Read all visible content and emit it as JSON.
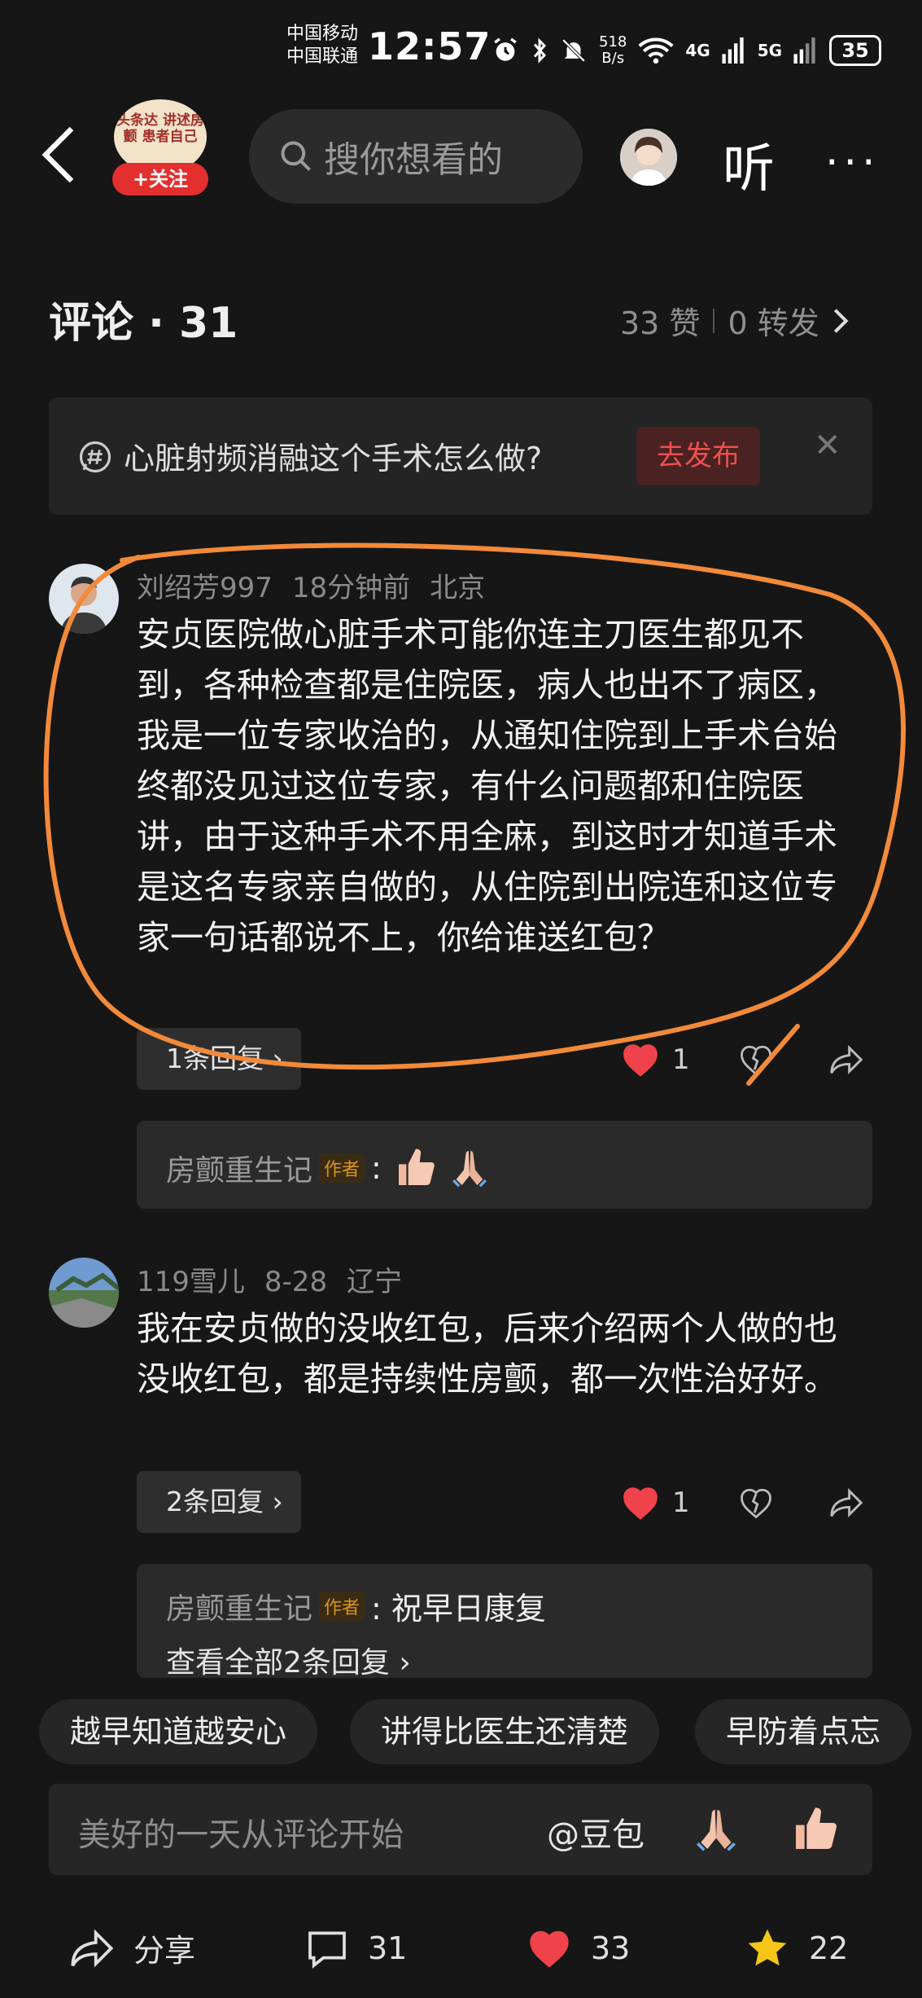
{
  "status_bar": {
    "carrier1": "中国移动",
    "carrier2": "中国联通",
    "time": "12:57",
    "speed_value": "518",
    "speed_unit": "B/s",
    "net1": "4G",
    "net2": "5G",
    "battery": "35"
  },
  "nav": {
    "brand_text": "头条达 讲述房颤 患者自己",
    "follow_label": "+关注",
    "search_placeholder": "搜你想看的",
    "listen_label": "听"
  },
  "comments_header": {
    "title": "评论 · 31",
    "likes": "33 赞",
    "reposts": "0 转发"
  },
  "topic": {
    "question": "心脏射频消融这个手术怎么做?",
    "publish_label": "去发布"
  },
  "comments": [
    {
      "user": "刘绍芳997",
      "time": "18分钟前",
      "location": "北京",
      "text": "安贞医院做心脏手术可能你连主刀医生都见不到，各种检查都是住院医，病人也出不了病区，我是一位专家收治的，从通知住院到上手术台始终都没见过这位专家，有什么问题都和住院医讲，由于这种手术不用全麻，到这时才知道手术是这名专家亲自做的，从住院到出院连和这位专家一句话都说不上，你给谁送红包？",
      "replies_label": "1条回复",
      "likes": "1",
      "sub_reply": {
        "name": "房颤重生记",
        "author_tag": "作者",
        "text": ":"
      }
    },
    {
      "user": "119雪儿",
      "time": "8-28",
      "location": "辽宁",
      "text": "我在安贞做的没收红包，后来介绍两个人做的也没收红包，都是持续性房颤，都一次性治好好。",
      "replies_label": "2条回复",
      "likes": "1",
      "sub_reply": {
        "name": "房颤重生记",
        "author_tag": "作者",
        "text": ": 祝早日康复",
        "view_all": "查看全部2条回复"
      }
    }
  ],
  "quick_chips": [
    "越早知道越安心",
    "讲得比医生还清楚",
    "早防着点忘"
  ],
  "input": {
    "placeholder": "美好的一天从评论开始",
    "at_label": "@豆包"
  },
  "bottom_bar": {
    "share_label": "分享",
    "comment_count": "31",
    "like_count": "33",
    "favorite_count": "22"
  },
  "colors": {
    "background": "#161616",
    "accent_red": "#e42f2f",
    "annotation_orange": "#f28a3a",
    "star_yellow": "#f5c518"
  }
}
